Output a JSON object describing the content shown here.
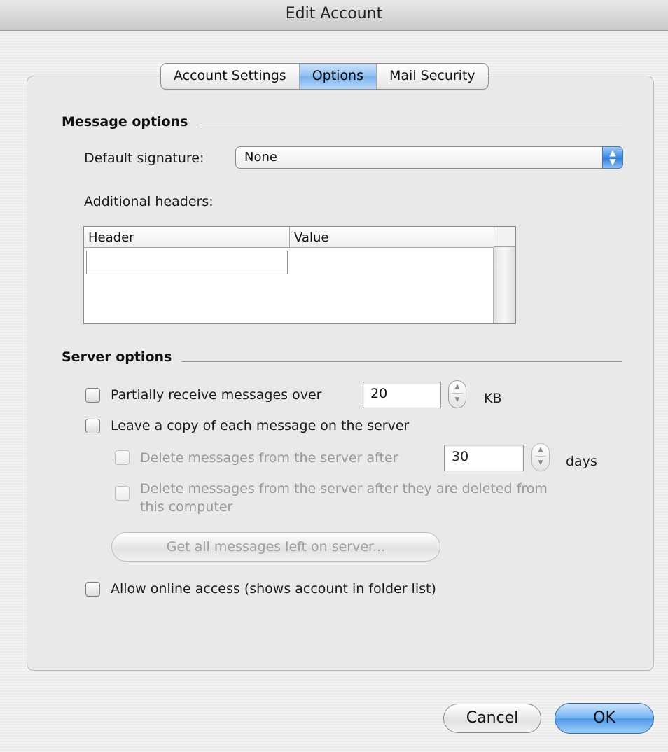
{
  "window": {
    "title": "Edit Account"
  },
  "tabs": [
    {
      "label": "Account Settings",
      "selected": false
    },
    {
      "label": "Options",
      "selected": true
    },
    {
      "label": "Mail Security",
      "selected": false
    }
  ],
  "message_options": {
    "heading": "Message options",
    "default_signature_label": "Default signature:",
    "default_signature_value": "None",
    "additional_headers_label": "Additional headers:",
    "table": {
      "columns": [
        "Header",
        "Value"
      ],
      "rows": []
    }
  },
  "server_options": {
    "heading": "Server options",
    "partial_receive": {
      "label": "Partially receive messages over",
      "value": "20",
      "unit": "KB",
      "checked": false
    },
    "leave_copy": {
      "label": "Leave a copy of each message on the server",
      "checked": false
    },
    "delete_after_days": {
      "label": "Delete messages from the server after",
      "value": "30",
      "unit": "days",
      "checked": false,
      "enabled": false
    },
    "delete_when_deleted": {
      "label_line1": "Delete messages from the server after they are deleted from",
      "label_line2": "this computer",
      "checked": false,
      "enabled": false
    },
    "get_all_button": "Get all messages left on server...",
    "online_access": {
      "label": "Allow online access (shows account in folder list)",
      "checked": false
    }
  },
  "buttons": {
    "cancel": "Cancel",
    "ok": "OK"
  },
  "colors": {
    "accent": "#5a9fea",
    "disabled_text": "#9a9a9a"
  }
}
